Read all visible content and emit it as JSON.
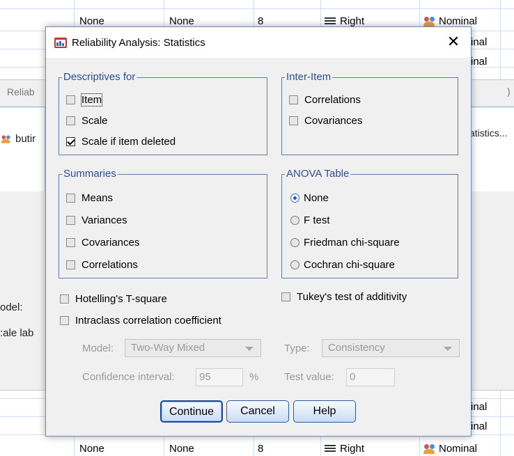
{
  "background": {
    "top_rows": [
      {
        "col1": "None",
        "col2": "None",
        "col3": "8",
        "align": "Right",
        "measure": "Nominal"
      },
      {
        "measure_partial": "inal"
      },
      {
        "measure_partial": "inal"
      }
    ],
    "bottom_rows": [
      {
        "measure_partial": "inal"
      },
      {
        "measure_partial": "inal"
      },
      {
        "col1": "None",
        "col2": "None",
        "col3": "8",
        "align": "Right",
        "measure": "Nominal"
      }
    ],
    "parent_dialog_title_partial": "Reliab",
    "parent_close_partial": ")",
    "variable_partial": "butir",
    "statistics_button_partial": "atistics...",
    "model_label_partial": "odel:",
    "scale_label_partial": ":ale lab"
  },
  "dialog": {
    "title": "Reliability Analysis: Statistics",
    "descriptives": {
      "legend": "Descriptives for",
      "options": [
        {
          "label": "Item",
          "checked": false
        },
        {
          "label": "Scale",
          "checked": false
        },
        {
          "label": "Scale if item deleted",
          "checked": true
        }
      ]
    },
    "inter_item": {
      "legend": "Inter-Item",
      "options": [
        {
          "label": "Correlations",
          "checked": false
        },
        {
          "label": "Covariances",
          "checked": false
        }
      ]
    },
    "summaries": {
      "legend": "Summaries",
      "options": [
        {
          "label": "Means",
          "checked": false
        },
        {
          "label": "Variances",
          "checked": false
        },
        {
          "label": "Covariances",
          "checked": false
        },
        {
          "label": "Correlations",
          "checked": false
        }
      ]
    },
    "anova": {
      "legend": "ANOVA Table",
      "options": [
        {
          "label": "None",
          "selected": true
        },
        {
          "label": "F test",
          "selected": false
        },
        {
          "label": "Friedman chi-square",
          "selected": false
        },
        {
          "label": "Cochran chi-square",
          "selected": false
        }
      ]
    },
    "hotelling": {
      "label": "Hotelling's T-square",
      "checked": false
    },
    "tukey": {
      "label": "Tukey's test of additivity",
      "checked": false
    },
    "intraclass": {
      "label": "Intraclass correlation coefficient",
      "checked": false
    },
    "model": {
      "label": "Model:",
      "value": "Two-Way Mixed"
    },
    "type": {
      "label": "Type:",
      "value": "Consistency"
    },
    "confidence": {
      "label": "Confidence interval:",
      "value": "95",
      "unit": "%"
    },
    "test_value": {
      "label": "Test value:",
      "value": "0"
    },
    "buttons": {
      "continue": "Continue",
      "cancel": "Cancel",
      "help": "Help"
    }
  }
}
